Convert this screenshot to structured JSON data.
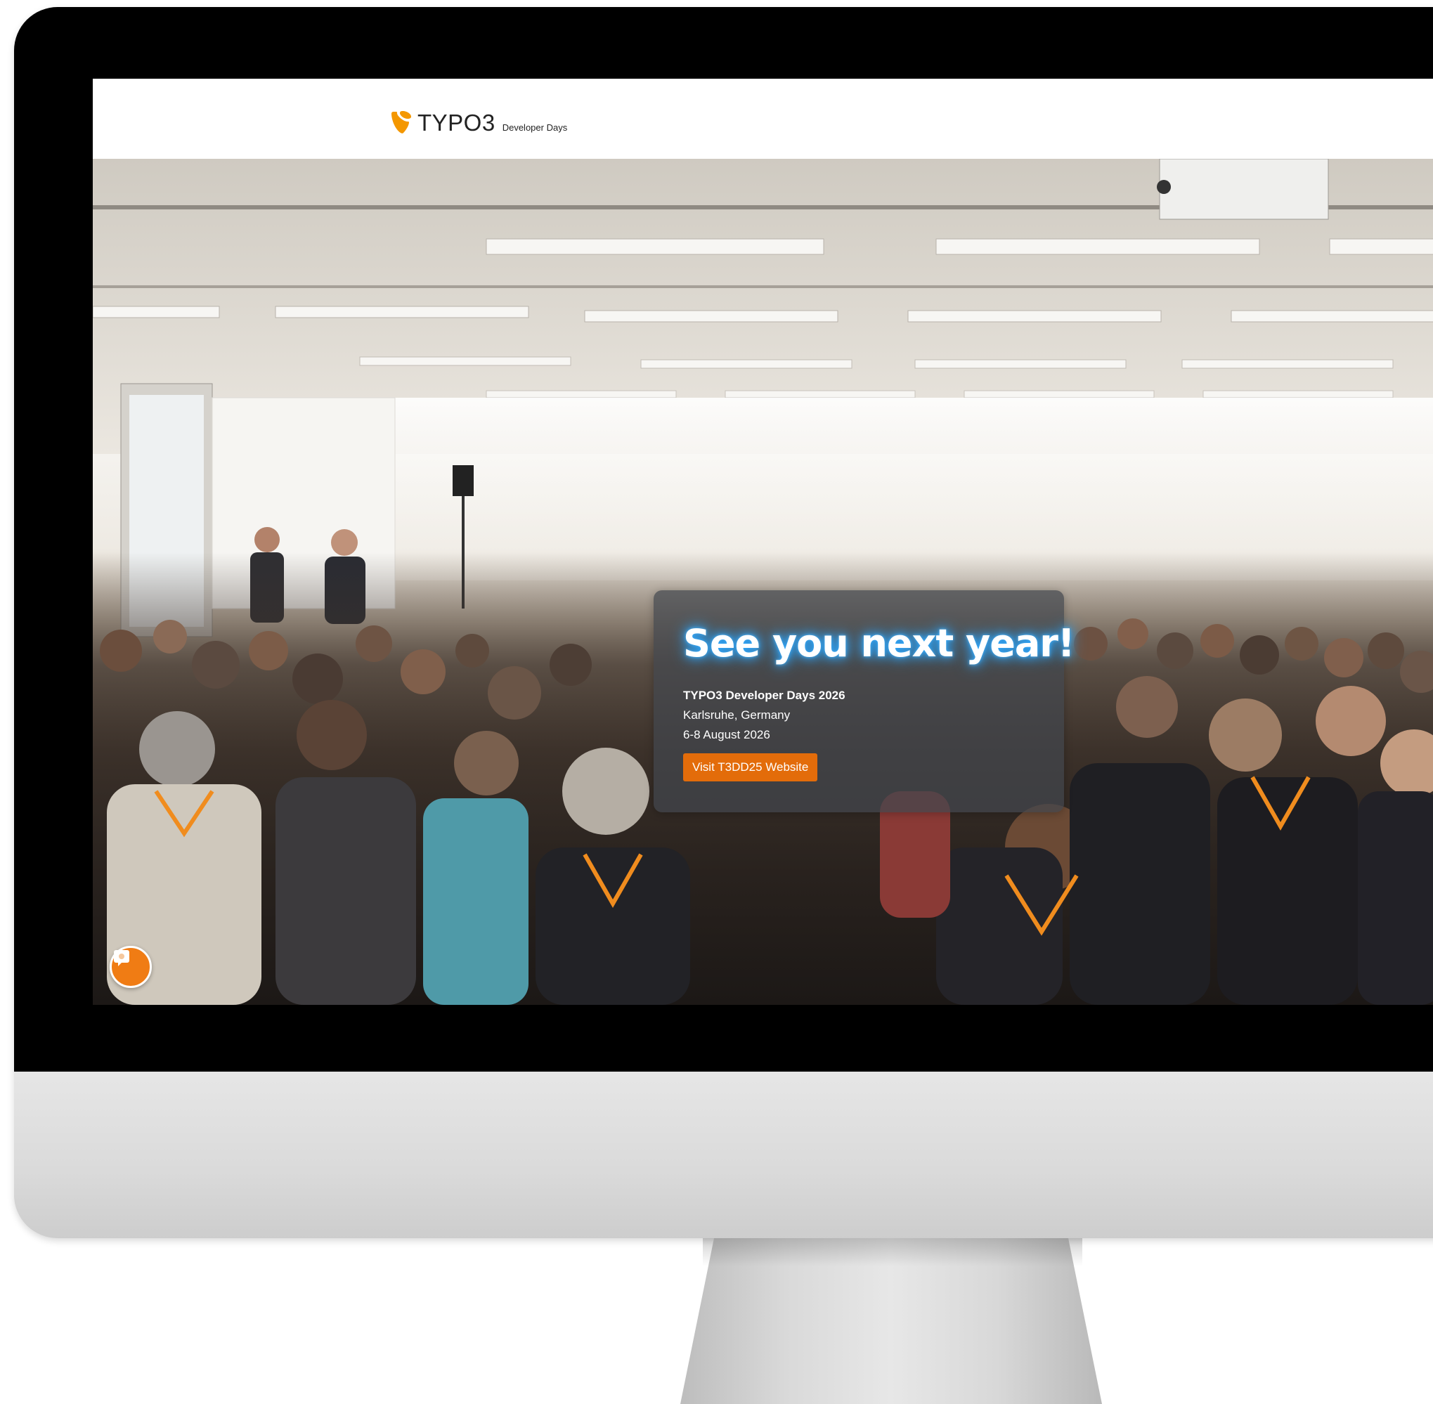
{
  "header": {
    "logo_wordmark": "TYPO3",
    "logo_subtitle": "Developer Days"
  },
  "hero": {
    "image_alt": "Audience at a conference talk",
    "card": {
      "title": "See you next year!",
      "event_name": "TYPO3 Developer Days 2026",
      "location": "Karlsruhe, Germany",
      "dates": "6-8 August 2026",
      "button_label": "Visit T3DD25 Website"
    }
  },
  "chat": {
    "icon": "chat-bubble-icon"
  },
  "colors": {
    "accent": "#e36c0a",
    "logo_orange": "#f49700",
    "card_background": "#42464e",
    "title_glow": "#2aa6ff"
  }
}
